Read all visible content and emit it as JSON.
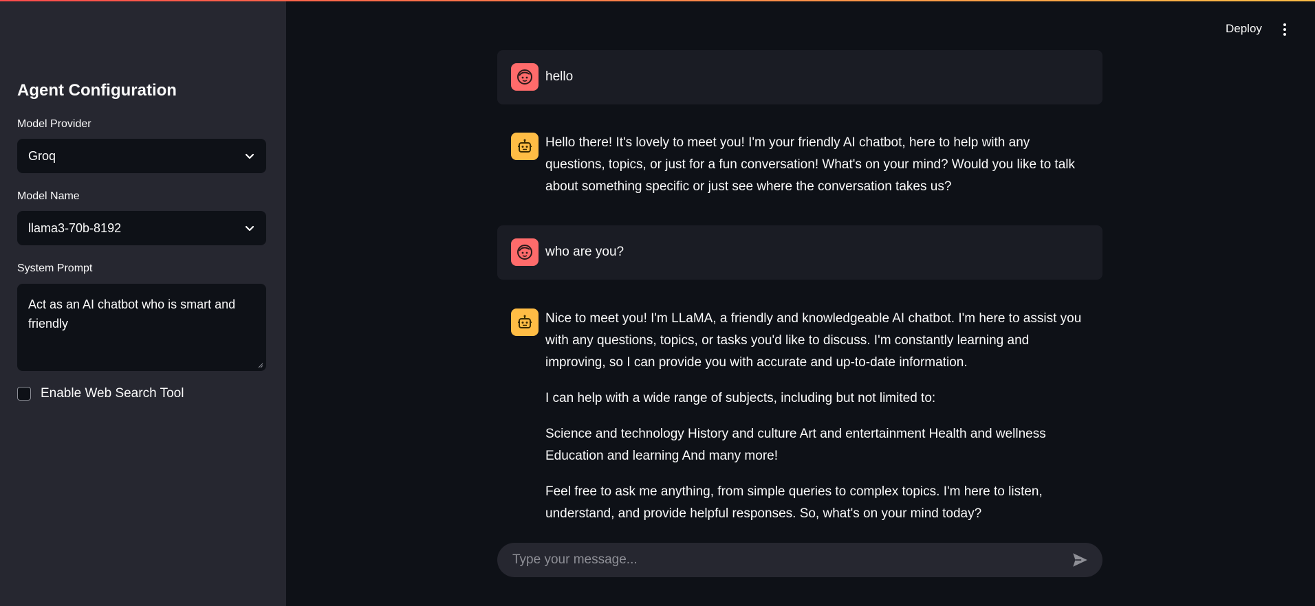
{
  "sidebar": {
    "title": "Agent Configuration",
    "model_provider": {
      "label": "Model Provider",
      "value": "Groq"
    },
    "model_name": {
      "label": "Model Name",
      "value": "llama3-70b-8192"
    },
    "system_prompt": {
      "label": "System Prompt",
      "value": "Act as an AI chatbot who is smart and friendly"
    },
    "web_search": {
      "label": "Enable Web Search Tool",
      "checked": false
    }
  },
  "header": {
    "deploy_label": "Deploy",
    "menu_icon": "kebab-menu-icon"
  },
  "messages": [
    {
      "role": "user",
      "avatar_icon": "user-face-icon",
      "paragraphs": [
        "hello"
      ]
    },
    {
      "role": "assistant",
      "avatar_icon": "robot-icon",
      "paragraphs": [
        "Hello there! It's lovely to meet you! I'm your friendly AI chatbot, here to help with any questions, topics, or just for a fun conversation! What's on your mind? Would you like to talk about something specific or just see where the conversation takes us?"
      ]
    },
    {
      "role": "user",
      "avatar_icon": "user-face-icon",
      "paragraphs": [
        "who are you?"
      ]
    },
    {
      "role": "assistant",
      "avatar_icon": "robot-icon",
      "paragraphs": [
        "Nice to meet you! I'm LLaMA, a friendly and knowledgeable AI chatbot. I'm here to assist you with any questions, topics, or tasks you'd like to discuss. I'm constantly learning and improving, so I can provide you with accurate and up-to-date information.",
        "I can help with a wide range of subjects, including but not limited to:",
        "Science and technology History and culture Art and entertainment Health and wellness Education and learning And many more!",
        "Feel free to ask me anything, from simple queries to complex topics. I'm here to listen, understand, and provide helpful responses. So, what's on your mind today?"
      ]
    }
  ],
  "chat_input": {
    "placeholder": "Type your message..."
  },
  "colors": {
    "accent_user": "#ff6b6b",
    "accent_bot": "#ffbd45",
    "background": "#0e1117",
    "sidebar": "#262730"
  }
}
